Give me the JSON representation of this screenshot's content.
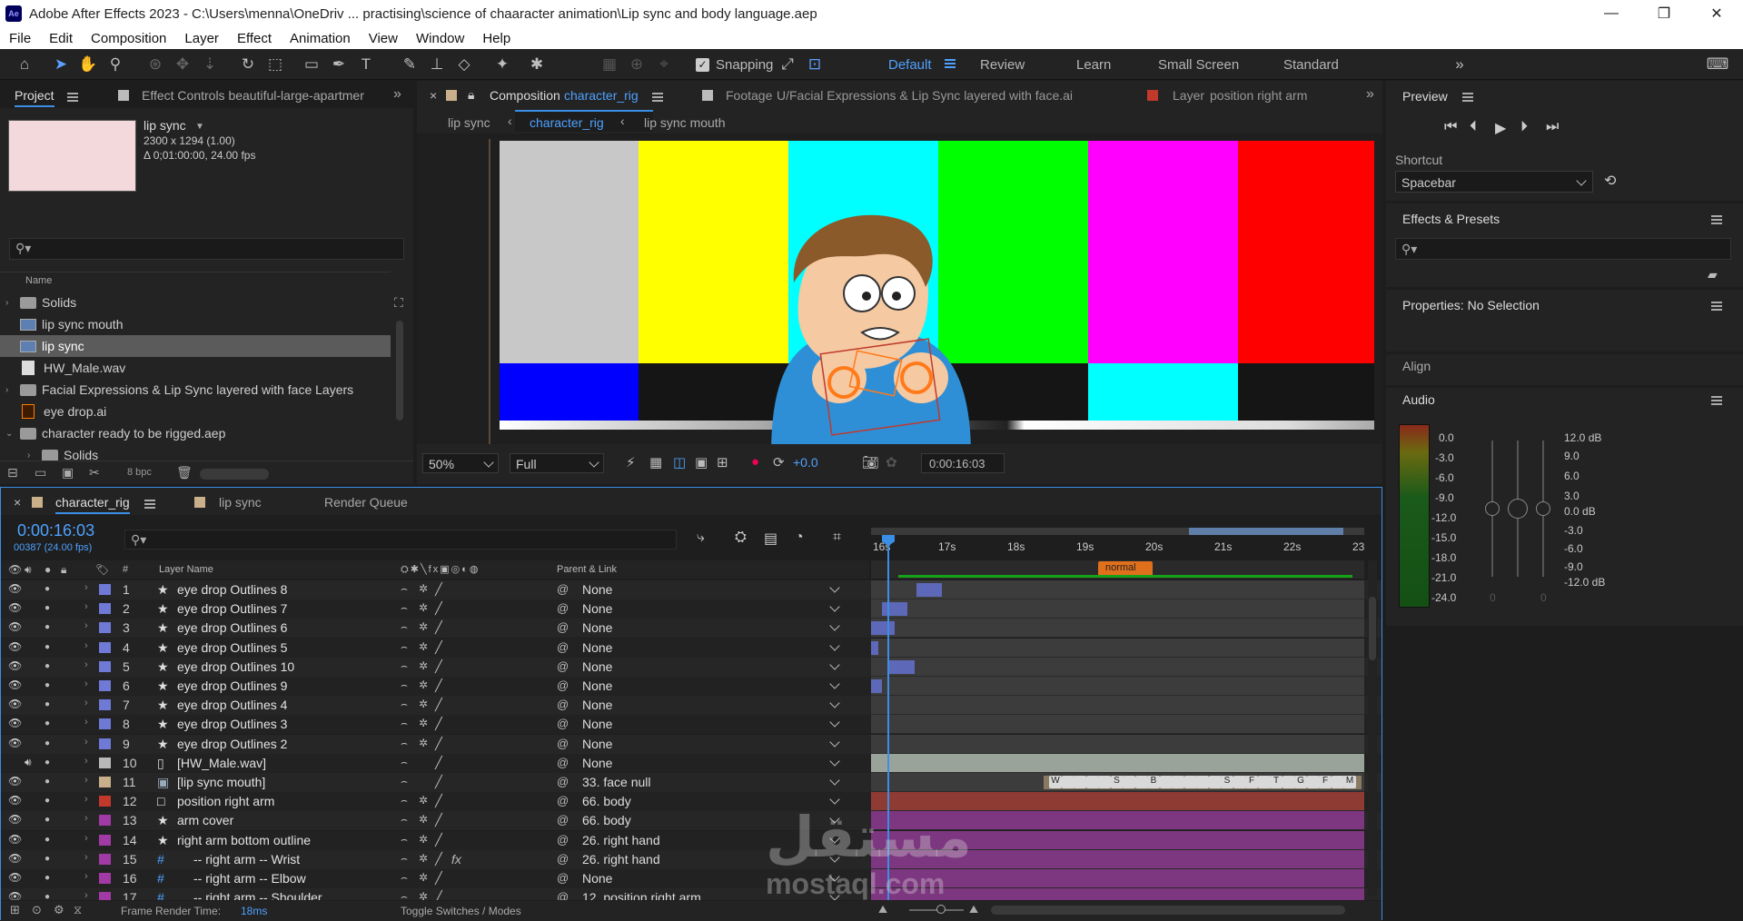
{
  "window": {
    "title": "Adobe After Effects 2023 - C:\\Users\\menna\\OneDriv ... practising\\science of chaaracter animation\\Lip sync and body language.aep",
    "app_icon": "Ae"
  },
  "menu": [
    "File",
    "Edit",
    "Composition",
    "Layer",
    "Effect",
    "Animation",
    "View",
    "Window",
    "Help"
  ],
  "toolbar": {
    "snapping_label": "Snapping",
    "workspaces": [
      "Default",
      "Review",
      "Learn",
      "Small Screen",
      "Standard"
    ],
    "active_workspace": "Default"
  },
  "project_panel": {
    "tab_project": "Project",
    "tab_effect_controls": "Effect Controls beautiful-large-apartmer",
    "selected_name": "lip sync",
    "selected_info1": "2300 x 1294 (1.00)",
    "selected_info2": "Δ 0;01:00:00, 24.00 fps",
    "col_name": "Name",
    "items": [
      {
        "label": "Solids",
        "type": "folder"
      },
      {
        "label": "lip sync mouth",
        "type": "comp"
      },
      {
        "label": "lip sync",
        "type": "comp"
      },
      {
        "label": "HW_Male.wav",
        "type": "audio"
      },
      {
        "label": "Facial Expressions & Lip Sync layered with face Layers",
        "type": "folder"
      },
      {
        "label": "eye drop.ai",
        "type": "ai"
      },
      {
        "label": "character ready to be rigged.aep",
        "type": "folder"
      },
      {
        "label": "Solids",
        "type": "folder"
      }
    ],
    "bpc": "8 bpc"
  },
  "comp_panel": {
    "tab_prefix": "Composition",
    "tab_name": "character_rig",
    "footage_prefix": "Footage",
    "footage_name": "U/Facial Expressions & Lip Sync layered with face.ai",
    "layer_prefix": "Layer",
    "layer_name": "position right arm",
    "breadcrumbs": [
      "lip sync",
      "character_rig",
      "lip sync mouth"
    ],
    "zoom": "50%",
    "resolution": "Full",
    "exposure": "+0.0",
    "timecode": "0:00:16:03",
    "colors": {
      "gray": "#c8c8c8",
      "yellow": "#ffff00",
      "cyan": "#00ffff",
      "green": "#00ff00",
      "magenta": "#ff00ff",
      "red": "#ff0000",
      "blue": "#0000ff"
    }
  },
  "right_panels": {
    "preview": "Preview",
    "shortcut_label": "Shortcut",
    "shortcut_value": "Spacebar",
    "effects_presets": "Effects & Presets",
    "properties": "Properties: No Selection",
    "align": "Align",
    "audio": "Audio",
    "audio_left_scale": [
      "0.0",
      "-3.0",
      "-6.0",
      "-9.0",
      "-12.0",
      "-15.0",
      "-18.0",
      "-21.0",
      "-24.0"
    ],
    "audio_right_scale": [
      "12.0 dB",
      "9.0",
      "6.0",
      "3.0",
      "0.0 dB",
      "-3.0",
      "-6.0",
      "-9.0",
      "-12.0 dB"
    ],
    "audio_zero_left": "0",
    "audio_zero_right": "0"
  },
  "timeline": {
    "tabs": [
      "character_rig",
      "lip sync",
      "Render Queue"
    ],
    "timecode": "0:00:16:03",
    "frame_info": "00387 (24.00 fps)",
    "col_layer_name": "Layer Name",
    "col_hash": "#",
    "col_parent": "Parent & Link",
    "ruler": [
      "16s",
      "17s",
      "18s",
      "19s",
      "20s",
      "21s",
      "22s",
      "23"
    ],
    "marker_label": "normal",
    "frame_render_label": "Frame Render Time:",
    "frame_render_value": "18ms",
    "toggle_label": "Toggle Switches / Modes",
    "layers": [
      {
        "num": "1",
        "name": "eye drop Outlines 8",
        "parent": "None",
        "color": "#6f79d6",
        "fx": false
      },
      {
        "num": "2",
        "name": "eye drop Outlines 7",
        "parent": "None",
        "color": "#6f79d6",
        "fx": false
      },
      {
        "num": "3",
        "name": "eye drop Outlines 6",
        "parent": "None",
        "color": "#6f79d6",
        "fx": false
      },
      {
        "num": "4",
        "name": "eye drop Outlines 5",
        "parent": "None",
        "color": "#6f79d6",
        "fx": false
      },
      {
        "num": "5",
        "name": "eye drop Outlines 10",
        "parent": "None",
        "color": "#6f79d6",
        "fx": false
      },
      {
        "num": "6",
        "name": "eye drop Outlines 9",
        "parent": "None",
        "color": "#6f79d6",
        "fx": false
      },
      {
        "num": "7",
        "name": "eye drop Outlines 4",
        "parent": "None",
        "color": "#6f79d6",
        "fx": false
      },
      {
        "num": "8",
        "name": "eye drop Outlines 3",
        "parent": "None",
        "color": "#6f79d6",
        "fx": false
      },
      {
        "num": "9",
        "name": "eye drop Outlines 2",
        "parent": "None",
        "color": "#6f79d6",
        "fx": false
      },
      {
        "num": "10",
        "name": "[HW_Male.wav]",
        "parent": "None",
        "color": "#b8b8b8",
        "fx": false
      },
      {
        "num": "11",
        "name": "[lip sync mouth]",
        "parent": "33. face null",
        "color": "#c9b08a",
        "fx": false
      },
      {
        "num": "12",
        "name": "position right arm",
        "parent": "66. body",
        "color": "#c0392b",
        "fx": false
      },
      {
        "num": "13",
        "name": "arm cover",
        "parent": "66. body",
        "color": "#a23aa6",
        "fx": false
      },
      {
        "num": "14",
        "name": "right arm bottom outline",
        "parent": "26. right hand",
        "color": "#a23aa6",
        "fx": false
      },
      {
        "num": "15",
        "name": "-- right arm -- Wrist",
        "parent": "26. right hand",
        "color": "#a23aa6",
        "fx": true
      },
      {
        "num": "16",
        "name": "-- right arm -- Elbow",
        "parent": "None",
        "color": "#a23aa6",
        "fx": false
      },
      {
        "num": "17",
        "name": "-- right arm -- Shoulder",
        "parent": "12. position right arm",
        "color": "#a23aa6",
        "fx": false
      }
    ],
    "keyframe_letters": [
      "W",
      "",
      "",
      "",
      "",
      "S",
      "",
      "",
      "B",
      "",
      "",
      "",
      "",
      "",
      "S",
      "",
      "F",
      "",
      "T",
      "",
      "G",
      "",
      "F",
      "",
      "M"
    ]
  },
  "watermark": {
    "arabic": "مستقل",
    "latin": "mostaql.com"
  }
}
